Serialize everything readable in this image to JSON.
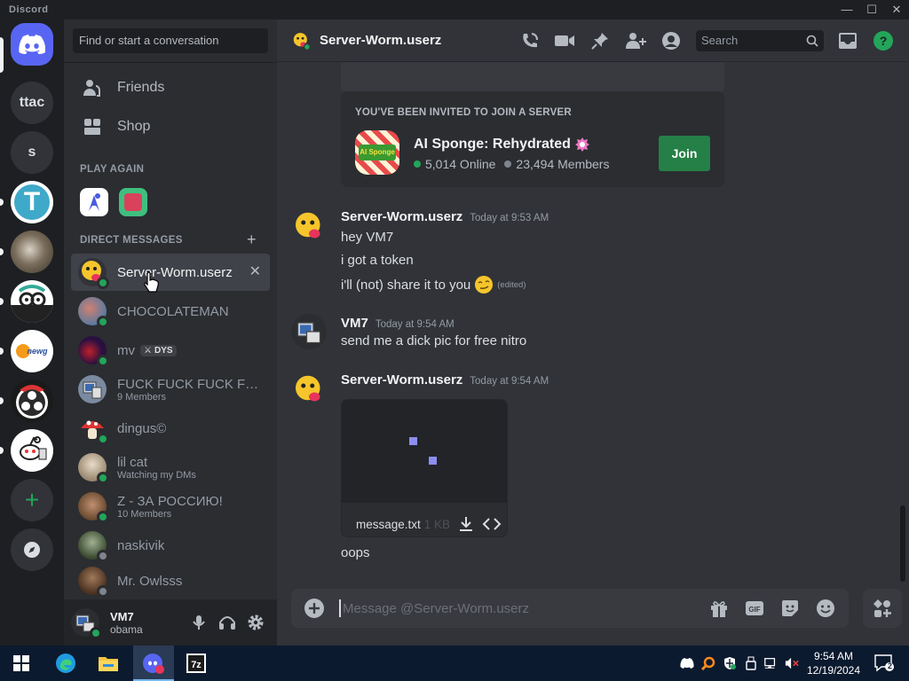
{
  "window": {
    "app_name": "Discord"
  },
  "rail": {
    "servers": [
      "ttac",
      "s"
    ]
  },
  "dm_sidebar": {
    "search_placeholder": "Find or start a conversation",
    "nav": {
      "friends": "Friends",
      "shop": "Shop"
    },
    "play_again_header": "PLAY AGAIN",
    "direct_messages_header": "DIRECT MESSAGES",
    "dms": [
      {
        "name": "Server-Worm.userz",
        "sub": "",
        "status": "online",
        "color": "#e8c12a"
      },
      {
        "name": "CHOCOLATEMAN",
        "sub": "",
        "status": "online",
        "color": "#7a6a5a"
      },
      {
        "name": "mv",
        "sub": "",
        "status": "online",
        "badge": "DYS",
        "color": "#1a1030"
      },
      {
        "name": "FUCK FUCK FUCK FU...",
        "sub": "9 Members",
        "status": "",
        "color": "#6b7a8f"
      },
      {
        "name": "dingus©",
        "sub": "",
        "status": "online",
        "color": "#c9464d"
      },
      {
        "name": "lil cat",
        "sub": "Watching my DMs",
        "status": "online",
        "color": "#b8a58c"
      },
      {
        "name": "Z - ЗА РОССИЮ!",
        "sub": "10 Members",
        "status": "",
        "color": "#8f6c50"
      },
      {
        "name": "naskivik",
        "sub": "",
        "status": "offline",
        "color": "#5d6d50"
      },
      {
        "name": "Mr. Owlsss",
        "sub": "",
        "status": "offline",
        "color": "#6b4f3a"
      }
    ]
  },
  "user_panel": {
    "name": "VM7",
    "status_text": "obama"
  },
  "chat": {
    "header_title": "Server-Worm.userz",
    "search_placeholder": "Search",
    "invite": {
      "heading": "YOU'VE BEEN INVITED TO JOIN A SERVER",
      "server_name": "AI Sponge: Rehydrated",
      "online": "5,014 Online",
      "members": "23,494 Members",
      "join_label": "Join"
    },
    "messages": [
      {
        "author": "Server-Worm.userz",
        "time": "Today at 9:53 AM",
        "lines": [
          "hey VM7",
          "i got a token",
          "i'll (not) share it to you"
        ],
        "edited": "(edited)"
      },
      {
        "author": "VM7",
        "time": "Today at 9:54 AM",
        "lines": [
          "send me a dick pic for free nitro"
        ]
      },
      {
        "author": "Server-Worm.userz",
        "time": "Today at 9:54 AM",
        "attachment": {
          "filename": "message.txt",
          "size": "1 KB"
        },
        "lines": [
          "oops"
        ]
      }
    ],
    "composer_placeholder": "Message @Server-Worm.userz"
  },
  "taskbar": {
    "time": "9:54 AM",
    "date": "12/19/2024",
    "notification_count": "2"
  }
}
